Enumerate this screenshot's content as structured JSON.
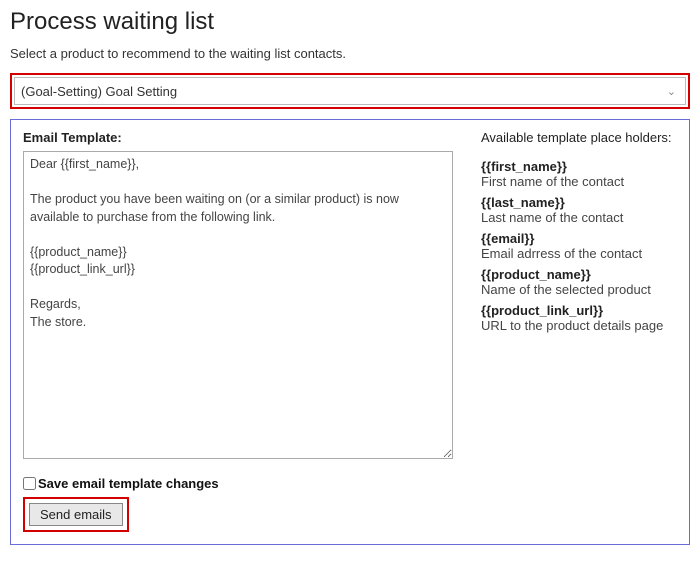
{
  "page": {
    "title": "Process waiting list",
    "subtitle": "Select a product to recommend to the waiting list contacts."
  },
  "product_select": {
    "selected": "(Goal-Setting) Goal Setting"
  },
  "template": {
    "label": "Email Template:",
    "body": "Dear {{first_name}},\n\nThe product you have been waiting on (or a similar product) is now available to purchase from the following link.\n\n{{product_name}}\n{{product_link_url}}\n\nRegards,\nThe store."
  },
  "placeholders": {
    "title": "Available template place holders:",
    "items": [
      {
        "token": "{{first_name}}",
        "desc": "First name of the contact"
      },
      {
        "token": "{{last_name}}",
        "desc": "Last name of the contact"
      },
      {
        "token": "{{email}}",
        "desc": "Email adrress of the contact"
      },
      {
        "token": "{{product_name}}",
        "desc": "Name of the selected product"
      },
      {
        "token": "{{product_link_url}}",
        "desc": "URL to the product details page"
      }
    ]
  },
  "save_checkbox": {
    "label": "Save email template changes",
    "checked": false
  },
  "send_button": {
    "label": "Send emails"
  }
}
